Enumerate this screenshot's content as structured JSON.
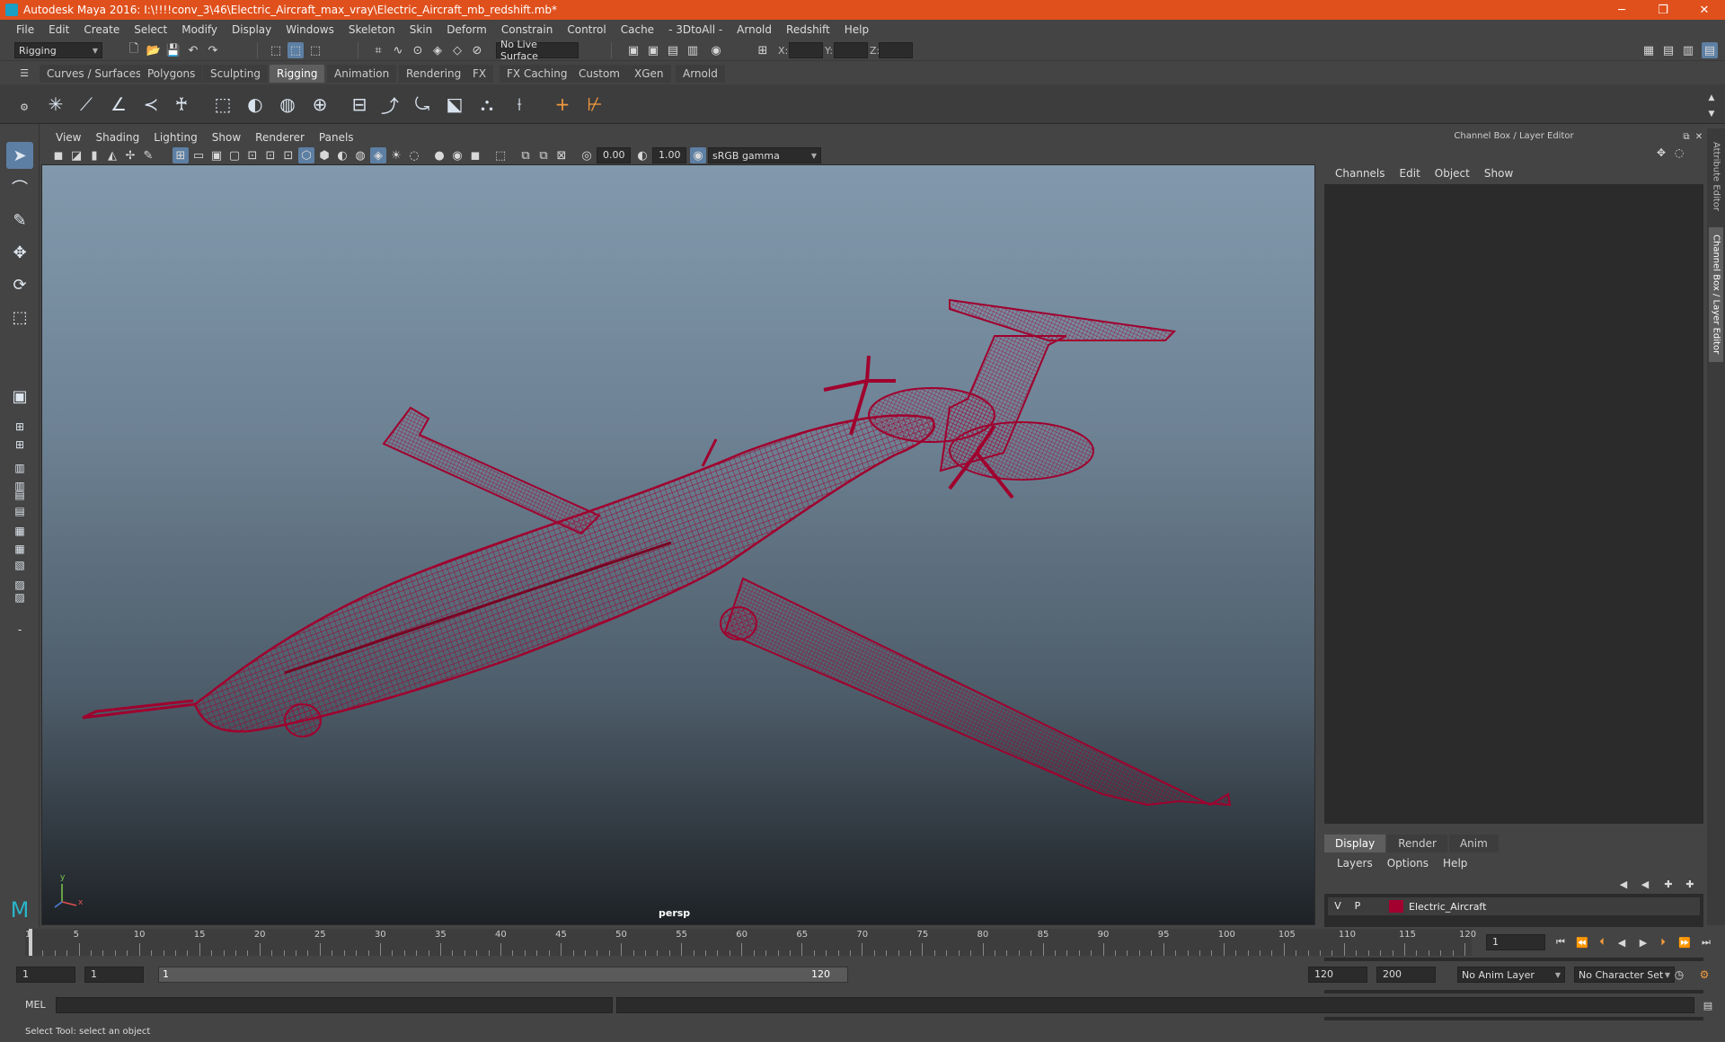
{
  "window": {
    "title": "Autodesk Maya 2016: I:\\!!!!conv_3\\46\\Electric_Aircraft_max_vray\\Electric_Aircraft_mb_redshift.mb*",
    "minimize": "─",
    "restore": "❐",
    "close": "✕"
  },
  "menubar": [
    "File",
    "Edit",
    "Create",
    "Select",
    "Modify",
    "Display",
    "Windows",
    "Skeleton",
    "Skin",
    "Deform",
    "Constrain",
    "Control",
    "Cache",
    "- 3DtoAll -",
    "Arnold",
    "Redshift",
    "Help"
  ],
  "statusline": {
    "mode": "Rigging",
    "live_surface": "No Live Surface",
    "x_label": "X:",
    "y_label": "Y:",
    "z_label": "Z:"
  },
  "shelf_tabs": [
    "Curves / Surfaces",
    "Polygons",
    "Sculpting",
    "Rigging",
    "Animation",
    "Rendering",
    "FX",
    "FX Caching",
    "Custom",
    "XGen",
    "Arnold"
  ],
  "shelf_active": "Rigging",
  "panel_menu": [
    "View",
    "Shading",
    "Lighting",
    "Show",
    "Renderer",
    "Panels"
  ],
  "panel_toolbar": {
    "exposure": "0.00",
    "gamma": "1.00",
    "color_space": "sRGB gamma"
  },
  "viewport": {
    "camera": "persp",
    "axis_y": "y",
    "axis_x": "x",
    "wire_color": "#a0002e"
  },
  "channel_box": {
    "title": "Channel Box / Layer Editor",
    "menu": [
      "Channels",
      "Edit",
      "Object",
      "Show"
    ]
  },
  "layer_editor": {
    "tabs": [
      "Display",
      "Render",
      "Anim"
    ],
    "active_tab": "Display",
    "menu": [
      "Layers",
      "Options",
      "Help"
    ],
    "layers": [
      {
        "visible": "V",
        "playback": "P",
        "name": "Electric_Aircraft",
        "color": "#a30030"
      }
    ]
  },
  "side_tabs": [
    "Attribute Editor",
    "Channel Box / Layer Editor"
  ],
  "timeline": {
    "ticks": [
      1,
      5,
      10,
      15,
      20,
      25,
      30,
      35,
      40,
      45,
      50,
      55,
      60,
      65,
      70,
      75,
      80,
      85,
      90,
      95,
      100,
      105,
      110,
      115,
      120
    ],
    "current_frame": "1"
  },
  "range": {
    "start": "1",
    "playback_start": "1",
    "slider_start": "1",
    "slider_end": "120",
    "playback_end": "120",
    "end": "200",
    "anim_layer": "No Anim Layer",
    "character_set": "No Character Set"
  },
  "command": {
    "label": "MEL"
  },
  "help_line": "Select Tool: select an object"
}
